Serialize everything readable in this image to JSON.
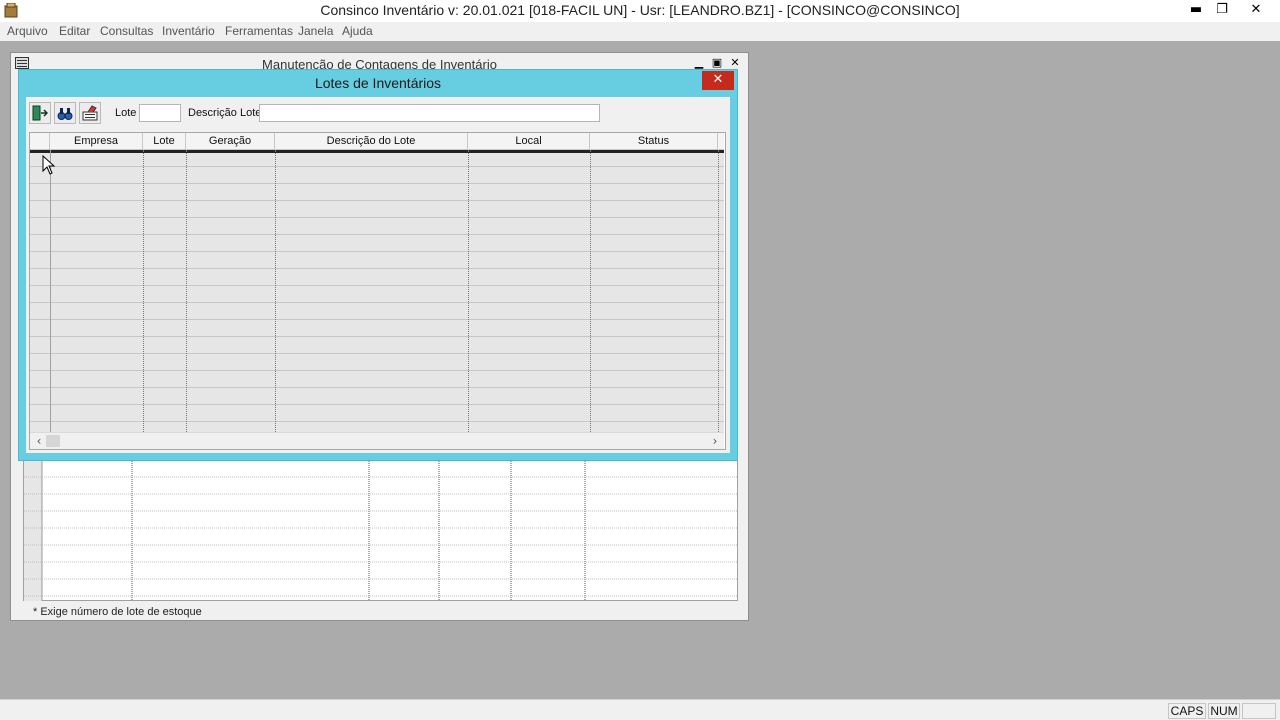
{
  "app": {
    "title": "Consinco Inventário  v: 20.01.021   [018-FACIL UN] - Usr: [LEANDRO.BZ1] - [CONSINCO@CONSINCO]",
    "minimize": "▬",
    "restore": "❐",
    "close": "✕"
  },
  "menu": {
    "items": [
      "Arquivo",
      "Editar",
      "Consultas",
      "Inventário",
      "Ferramentas",
      "Janela",
      "Ajuda"
    ]
  },
  "parent_window": {
    "title": "Manutenção de Contagens de Inventário",
    "footnote": "* Exige número de lote de estoque"
  },
  "dialog": {
    "title": "Lotes de Inventários",
    "close": "✕",
    "toolbar": {
      "lote_label": "Lote",
      "lote_value": "",
      "descricao_label": "Descrição Lote",
      "descricao_value": ""
    },
    "grid": {
      "columns": [
        "Empresa",
        "Lote",
        "Geração",
        "Descrição do Lote",
        "Local",
        "Status"
      ],
      "rows": []
    },
    "scroll_left": "‹",
    "scroll_right": "›"
  },
  "statusbar": {
    "caps": "CAPS",
    "num": "NUM"
  },
  "colors": {
    "dialog_frame": "#67cde1",
    "close_button": "#c42b1c",
    "desktop": "#ababab"
  }
}
